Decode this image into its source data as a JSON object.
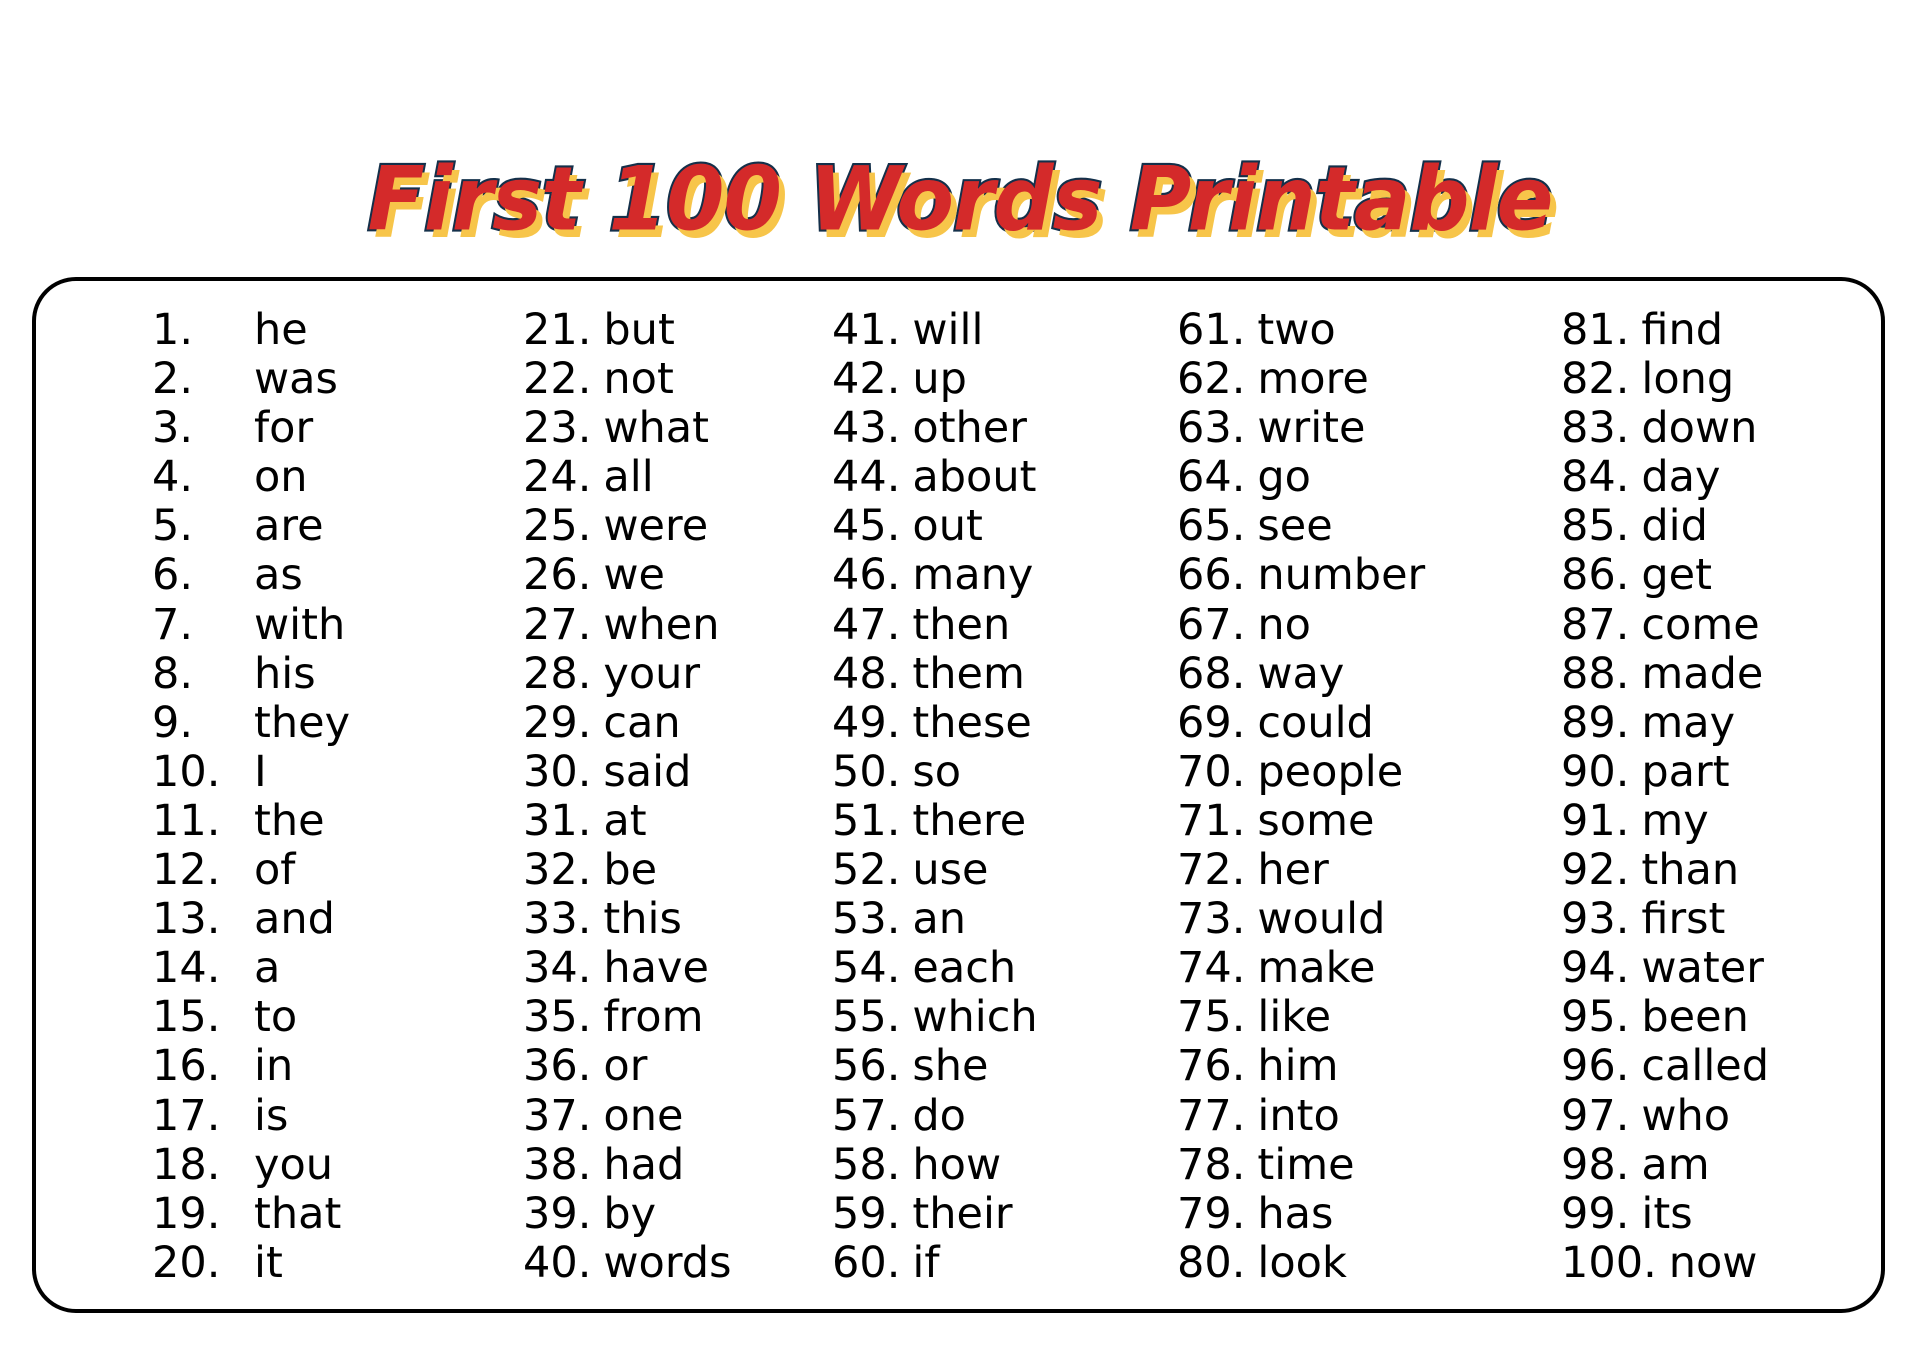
{
  "title": "First 100 Words Printable",
  "colors": {
    "title_fill": "#d42a2a",
    "title_outline": "#14304a",
    "title_shadow": "#f7c54a",
    "border": "#000000",
    "text": "#000000"
  },
  "columns": [
    {
      "items": [
        {
          "num": "1.",
          "word": "he"
        },
        {
          "num": "2.",
          "word": "was"
        },
        {
          "num": "3.",
          "word": "for"
        },
        {
          "num": "4.",
          "word": "on"
        },
        {
          "num": "5.",
          "word": "are"
        },
        {
          "num": "6.",
          "word": "as"
        },
        {
          "num": "7.",
          "word": "with"
        },
        {
          "num": "8.",
          "word": "his"
        },
        {
          "num": "9.",
          "word": "they"
        },
        {
          "num": "10.",
          "word": "I"
        },
        {
          "num": "11.",
          "word": "the"
        },
        {
          "num": "12.",
          "word": "of"
        },
        {
          "num": "13.",
          "word": "and"
        },
        {
          "num": "14.",
          "word": "a"
        },
        {
          "num": "15.",
          "word": "to"
        },
        {
          "num": "16.",
          "word": "in"
        },
        {
          "num": "17.",
          "word": "is"
        },
        {
          "num": "18.",
          "word": "you"
        },
        {
          "num": "19.",
          "word": "that"
        },
        {
          "num": "20.",
          "word": "it"
        }
      ]
    },
    {
      "items": [
        {
          "num": "21.",
          "word": "but"
        },
        {
          "num": "22.",
          "word": "not"
        },
        {
          "num": "23.",
          "word": "what"
        },
        {
          "num": "24.",
          "word": "all"
        },
        {
          "num": "25.",
          "word": "were"
        },
        {
          "num": "26.",
          "word": "we"
        },
        {
          "num": "27.",
          "word": "when"
        },
        {
          "num": "28.",
          "word": "your"
        },
        {
          "num": "29.",
          "word": "can"
        },
        {
          "num": "30.",
          "word": "said"
        },
        {
          "num": "31.",
          "word": "at"
        },
        {
          "num": "32.",
          "word": "be"
        },
        {
          "num": "33.",
          "word": "this"
        },
        {
          "num": "34.",
          "word": "have"
        },
        {
          "num": "35.",
          "word": "from"
        },
        {
          "num": "36.",
          "word": "or"
        },
        {
          "num": "37.",
          "word": "one"
        },
        {
          "num": "38.",
          "word": "had"
        },
        {
          "num": "39.",
          "word": "by"
        },
        {
          "num": "40.",
          "word": "words"
        }
      ]
    },
    {
      "items": [
        {
          "num": "41.",
          "word": "will"
        },
        {
          "num": "42.",
          "word": "up"
        },
        {
          "num": "43.",
          "word": "other"
        },
        {
          "num": "44.",
          "word": "about"
        },
        {
          "num": "45.",
          "word": "out"
        },
        {
          "num": "46.",
          "word": "many"
        },
        {
          "num": "47.",
          "word": "then"
        },
        {
          "num": "48.",
          "word": "them"
        },
        {
          "num": "49.",
          "word": "these"
        },
        {
          "num": "50.",
          "word": "so"
        },
        {
          "num": "51.",
          "word": "there"
        },
        {
          "num": "52.",
          "word": "use"
        },
        {
          "num": "53.",
          "word": "an"
        },
        {
          "num": "54.",
          "word": "each"
        },
        {
          "num": "55.",
          "word": "which"
        },
        {
          "num": "56.",
          "word": "she"
        },
        {
          "num": "57.",
          "word": "do"
        },
        {
          "num": "58.",
          "word": "how"
        },
        {
          "num": "59.",
          "word": "their"
        },
        {
          "num": "60.",
          "word": "if"
        }
      ]
    },
    {
      "items": [
        {
          "num": "61.",
          "word": "two"
        },
        {
          "num": "62.",
          "word": "more"
        },
        {
          "num": "63.",
          "word": "write"
        },
        {
          "num": "64.",
          "word": "go"
        },
        {
          "num": "65.",
          "word": "see"
        },
        {
          "num": "66.",
          "word": "number"
        },
        {
          "num": "67.",
          "word": "no"
        },
        {
          "num": "68.",
          "word": "way"
        },
        {
          "num": "69.",
          "word": "could"
        },
        {
          "num": "70.",
          "word": "people"
        },
        {
          "num": "71.",
          "word": "some"
        },
        {
          "num": "72.",
          "word": "her"
        },
        {
          "num": "73.",
          "word": "would"
        },
        {
          "num": "74.",
          "word": "make"
        },
        {
          "num": "75.",
          "word": "like"
        },
        {
          "num": "76.",
          "word": "him"
        },
        {
          "num": "77.",
          "word": "into"
        },
        {
          "num": "78.",
          "word": "time"
        },
        {
          "num": "79.",
          "word": "has"
        },
        {
          "num": "80.",
          "word": "look"
        }
      ]
    },
    {
      "items": [
        {
          "num": "81.",
          "word": "find"
        },
        {
          "num": "82.",
          "word": "long"
        },
        {
          "num": "83.",
          "word": "down"
        },
        {
          "num": "84.",
          "word": "day"
        },
        {
          "num": "85.",
          "word": "did"
        },
        {
          "num": "86.",
          "word": "get"
        },
        {
          "num": "87.",
          "word": "come"
        },
        {
          "num": "88.",
          "word": "made"
        },
        {
          "num": "89.",
          "word": "may"
        },
        {
          "num": "90.",
          "word": "part"
        },
        {
          "num": "91.",
          "word": "my"
        },
        {
          "num": "92.",
          "word": "than"
        },
        {
          "num": "93.",
          "word": "first"
        },
        {
          "num": "94.",
          "word": "water"
        },
        {
          "num": "95.",
          "word": "been"
        },
        {
          "num": "96.",
          "word": "called"
        },
        {
          "num": "97.",
          "word": "who"
        },
        {
          "num": "98.",
          "word": "am"
        },
        {
          "num": "99.",
          "word": "its"
        },
        {
          "num": "100.",
          "word": "now"
        }
      ]
    }
  ]
}
